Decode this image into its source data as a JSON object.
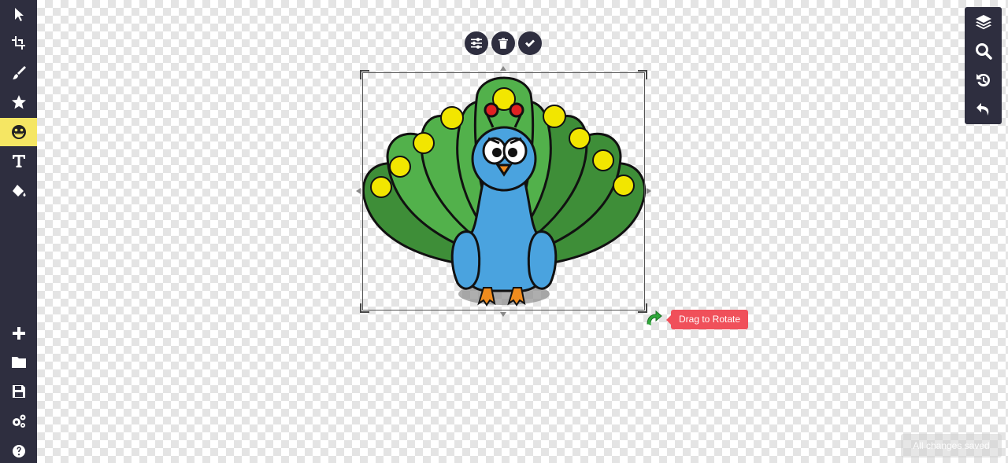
{
  "left_toolbar": {
    "tools": [
      {
        "name": "pointer",
        "icon": "pointer-icon"
      },
      {
        "name": "crop",
        "icon": "crop-icon"
      },
      {
        "name": "draw",
        "icon": "brush-icon"
      },
      {
        "name": "shapes",
        "icon": "star-icon"
      },
      {
        "name": "stickers",
        "icon": "smiley-icon",
        "active": true
      },
      {
        "name": "text",
        "icon": "text-icon"
      },
      {
        "name": "fill",
        "icon": "paint-bucket-icon"
      }
    ],
    "bottom_tools": [
      {
        "name": "new",
        "icon": "plus-icon"
      },
      {
        "name": "open",
        "icon": "folder-icon"
      },
      {
        "name": "save",
        "icon": "floppy-icon"
      },
      {
        "name": "settings",
        "icon": "gears-icon"
      },
      {
        "name": "help",
        "icon": "help-icon"
      }
    ],
    "active_color": "#f5e663",
    "background": "#2e2e3f"
  },
  "object_toolbar": {
    "buttons": [
      {
        "name": "adjust",
        "icon": "sliders-icon"
      },
      {
        "name": "delete",
        "icon": "trash-icon"
      },
      {
        "name": "confirm",
        "icon": "check-icon"
      }
    ]
  },
  "rotate": {
    "tooltip": "Drag to Rotate",
    "tooltip_color": "#f0505a"
  },
  "right_toolbar": {
    "tools": [
      {
        "name": "layers",
        "icon": "layers-icon"
      },
      {
        "name": "zoom",
        "icon": "search-icon"
      },
      {
        "name": "history",
        "icon": "history-icon"
      },
      {
        "name": "undo",
        "icon": "undo-icon"
      }
    ]
  },
  "status": {
    "text": "All changes saved"
  }
}
